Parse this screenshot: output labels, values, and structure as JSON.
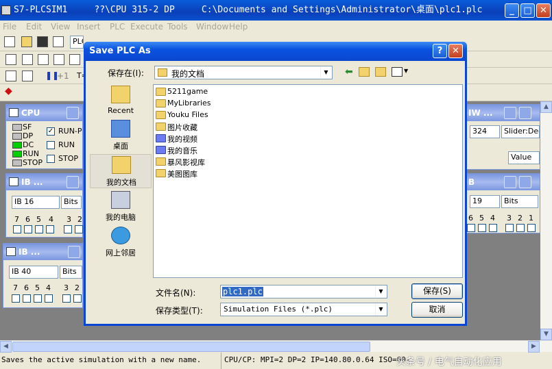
{
  "window": {
    "title": "S7-PLCSIM1     ??\\CPU 315-2 DP     C:\\Documents and Settings\\Administrator\\桌面\\plc1.plc",
    "min": "_",
    "max": "□",
    "close": "✕"
  },
  "menu": [
    "File",
    "Edit",
    "View",
    "Insert",
    "PLC",
    "Execute",
    "Tools",
    "Window",
    "Help"
  ],
  "toolbar": {
    "plc_combo": "PLC",
    "runmode_label": "+1",
    "t_label": "T="
  },
  "cpu_window": {
    "title": "CPU",
    "leds": [
      {
        "label": "SF",
        "color": "#c0c0c0"
      },
      {
        "label": "DP",
        "color": "#c0c0c0"
      },
      {
        "label": "DC",
        "color": "#00d000"
      },
      {
        "label": "RUN",
        "color": "#00d000"
      },
      {
        "label": "STOP",
        "color": "#c0c0c0"
      }
    ],
    "modes": [
      {
        "label": "RUN-P",
        "checked": true
      },
      {
        "label": "RUN",
        "checked": false
      },
      {
        "label": "STOP",
        "checked": false
      }
    ]
  },
  "ib_windows": [
    {
      "title": "IB   ...",
      "address": "IB  16",
      "format": "Bits",
      "bits": [
        "7",
        "6",
        "5",
        "4",
        "3",
        "2"
      ]
    },
    {
      "title": "IB   ...",
      "address": "IB  40",
      "format": "Bits",
      "bits": [
        "7",
        "6",
        "5",
        "4",
        "3",
        "2"
      ]
    }
  ],
  "right_windows": {
    "top_title": "IW  ...",
    "top_value": "324",
    "top_format": "Slider:Dec",
    "top_value_label": "Value",
    "bottom_title": "B",
    "bottom_address": "19",
    "bottom_format": "Bits",
    "bottom_bits": [
      "6",
      "5",
      "4",
      "3",
      "2",
      "1"
    ]
  },
  "dialog": {
    "title": "Save PLC As",
    "help": "?",
    "close": "✕",
    "save_in_label": "保存在(I):",
    "save_in_value": "我的文档",
    "places": [
      "Recent",
      "桌面",
      "我的文档",
      "我的电脑",
      "网上邻居"
    ],
    "files": [
      {
        "name": "5211game",
        "type": "folder"
      },
      {
        "name": "MyLibraries",
        "type": "folder"
      },
      {
        "name": "Youku Files",
        "type": "folder"
      },
      {
        "name": "图片收藏",
        "type": "folder"
      },
      {
        "name": "我的视频",
        "type": "media"
      },
      {
        "name": "我的音乐",
        "type": "media"
      },
      {
        "name": "暴风影视库",
        "type": "folder"
      },
      {
        "name": "美图图库",
        "type": "folder"
      }
    ],
    "filename_label": "文件名(N):",
    "filename_value": "plc1.plc",
    "filetype_label": "保存类型(T):",
    "filetype_value": "Simulation Files (*.plc)",
    "save_button": "保存(S)",
    "cancel_button": "取消"
  },
  "status": {
    "left": "Saves the active simulation with a new name.",
    "right": "CPU/CP:  MPI=2 DP=2 IP=140.80.0.64 ISO=00-",
    "watermark": "头条号 / 电气自动化应用"
  },
  "colors": {
    "title_blue": "#0a46d6",
    "led_green": "#00d000",
    "mdi_bg": "#808080"
  }
}
